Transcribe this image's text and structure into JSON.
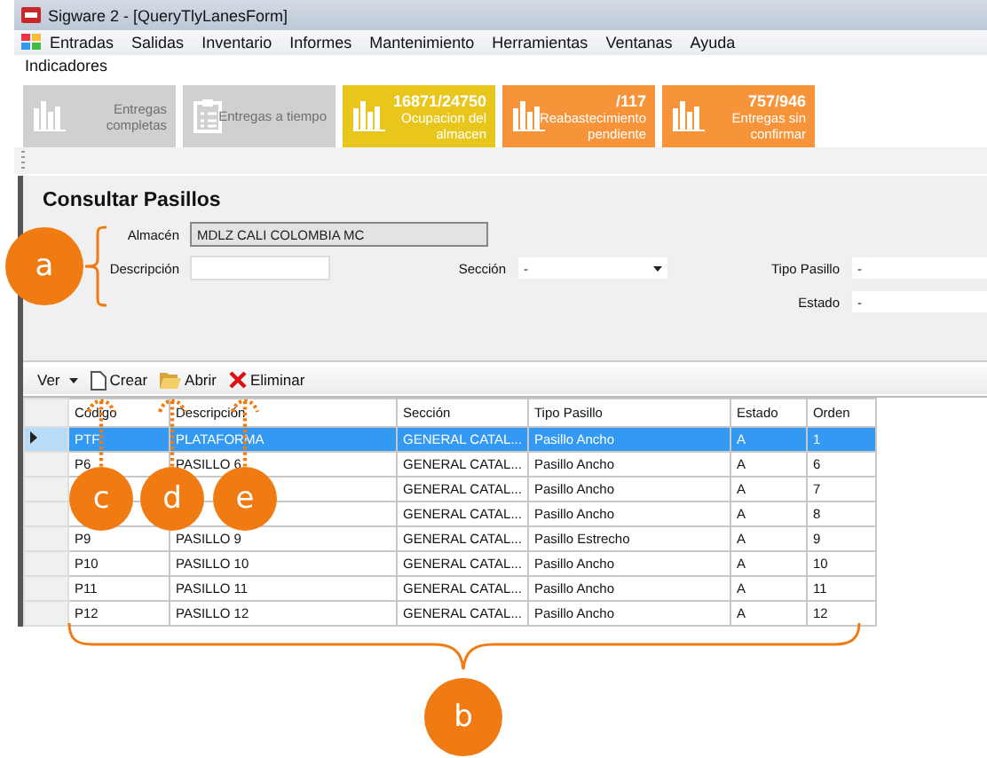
{
  "window": {
    "title": "Sigware 2 - [QueryTlyLanesForm]"
  },
  "menu": [
    "Entradas",
    "Salidas",
    "Inventario",
    "Informes",
    "Mantenimiento",
    "Herramientas",
    "Ventanas",
    "Ayuda"
  ],
  "indicators_label": "Indicadores",
  "indicators": [
    {
      "kind": "chart",
      "label": "Entregas completas",
      "color": "#d0d0d0"
    },
    {
      "kind": "clipboard",
      "label": "Entregas a tiempo",
      "color": "#d0d0d0"
    },
    {
      "kind": "chart",
      "value": "16871/24750",
      "label": "Ocupacion del almacen",
      "color": "#e8c61c"
    },
    {
      "kind": "chart",
      "value": "/117",
      "label": "Reabastecimiento pendiente",
      "color": "#f7943a"
    },
    {
      "kind": "chart",
      "value": "757/946",
      "label": "Entregas sin confirmar",
      "color": "#f7943a"
    }
  ],
  "form": {
    "title": "Consultar Pasillos",
    "fields": [
      {
        "label": "Almacén",
        "kind": "text",
        "value": "MDLZ CALI COLOMBIA MC",
        "disabled": true
      },
      {
        "label": "Descripción",
        "kind": "text",
        "disabled": false
      },
      {
        "label": "Sección",
        "kind": "combo",
        "value": "-"
      },
      {
        "label": "Tipo Pasillo",
        "kind": "combo",
        "value": "-"
      },
      {
        "label": "Estado",
        "kind": "combo",
        "value": "-"
      }
    ]
  },
  "toolbar": [
    {
      "kind": "dropdown",
      "label": "Ver"
    },
    {
      "kind": "new",
      "label": "Crear"
    },
    {
      "kind": "open",
      "label": "Abrir"
    },
    {
      "kind": "delete",
      "label": "Eliminar"
    }
  ],
  "table": {
    "columns": [
      "Código",
      "Descripción",
      "Sección",
      "Tipo Pasillo",
      "Estado",
      "Orden"
    ],
    "rows": [
      {
        "selected": true,
        "cells": [
          "PTF",
          "PLATAFORMA",
          "GENERAL CATAL...",
          "Pasillo Ancho",
          "A",
          "1"
        ]
      },
      {
        "selected": false,
        "cells": [
          "P6",
          "PASILLO 6",
          "GENERAL CATAL...",
          "Pasillo Ancho",
          "A",
          "6"
        ]
      },
      {
        "selected": false,
        "cells": [
          null,
          null,
          "GENERAL CATAL...",
          "Pasillo Ancho",
          "A",
          "7"
        ]
      },
      {
        "selected": false,
        "cells": [
          null,
          null,
          "GENERAL CATAL...",
          "Pasillo Ancho",
          "A",
          "8"
        ]
      },
      {
        "selected": false,
        "cells": [
          "P9",
          "PASILLO 9",
          "GENERAL CATAL...",
          "Pasillo Estrecho",
          "A",
          "9"
        ]
      },
      {
        "selected": false,
        "cells": [
          "P10",
          "PASILLO 10",
          "GENERAL CATAL...",
          "Pasillo Ancho",
          "A",
          "10"
        ]
      },
      {
        "selected": false,
        "cells": [
          "P11",
          "PASILLO 11",
          "GENERAL CATAL...",
          "Pasillo Ancho",
          "A",
          "11"
        ]
      },
      {
        "selected": false,
        "cells": [
          "P12",
          "PASILLO 12",
          "GENERAL CATAL...",
          "Pasillo Ancho",
          "A",
          "12"
        ]
      }
    ]
  },
  "callouts": [
    {
      "label": "a"
    },
    {
      "label": "b"
    },
    {
      "label": "c"
    },
    {
      "label": "d"
    },
    {
      "label": "e"
    }
  ]
}
